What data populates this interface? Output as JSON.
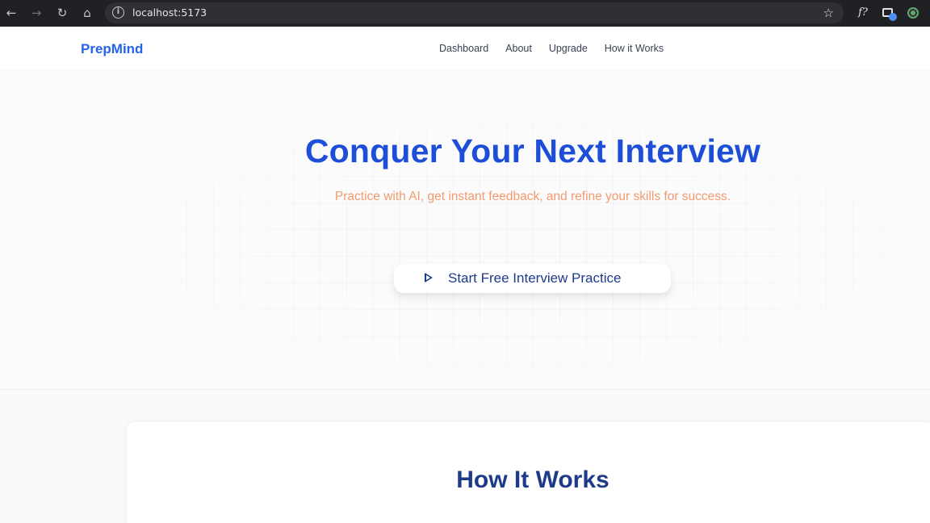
{
  "browser": {
    "url": "localhost:5173",
    "icons": [
      "back-icon",
      "forward-icon",
      "reload-icon",
      "home-icon",
      "site-info-icon",
      "bookmark-star-icon",
      "function-extension-icon",
      "window-extension-icon",
      "green-extension-icon"
    ]
  },
  "header": {
    "logo": "PrepMind",
    "nav": [
      "Dashboard",
      "About",
      "Upgrade",
      "How it Works"
    ]
  },
  "hero": {
    "title": "Conquer Your Next Interview",
    "subtitle": "Practice with AI, get instant feedback, and refine your skills for success.",
    "cta_label": "Start Free Interview Practice"
  },
  "how_it_works": {
    "title": "How It Works"
  },
  "colors": {
    "brand_blue": "#2563eb",
    "title_blue": "#1d4ed8",
    "dark_blue": "#1e3a8a",
    "subtitle_orange": "#f29b6e"
  }
}
